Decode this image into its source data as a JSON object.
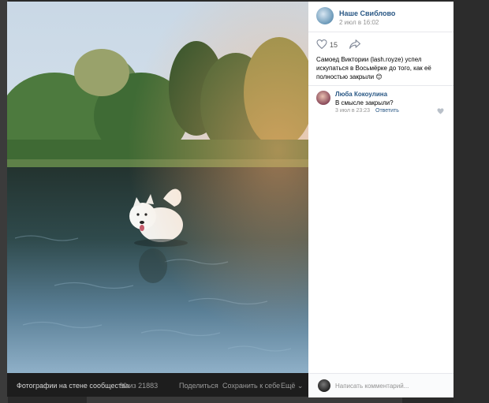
{
  "post": {
    "group_name": "Наше Свиблово",
    "date": "2 июл в 16:02",
    "likes": "15",
    "text": "Самоед Виктории (lash.royze) успел искупаться в Восьмёрке до того, как её полностью закрыли 😊"
  },
  "photo_bar": {
    "album": "Фотографии на стене сообщества",
    "counter": "30 из 21883",
    "share": "Поделиться",
    "save": "Сохранить к себе",
    "more": "Ещё ⌄"
  },
  "comments": [
    {
      "author": "Люба Кокоулина",
      "text": "В смысле закрыли?",
      "date": "3 июл в 23:23",
      "reply": "Ответить"
    }
  ],
  "input": {
    "placeholder": "Написать комментарий..."
  },
  "colors": {
    "link": "#2a5885",
    "muted": "#939393",
    "bar_bg": "#1d1d1d"
  }
}
